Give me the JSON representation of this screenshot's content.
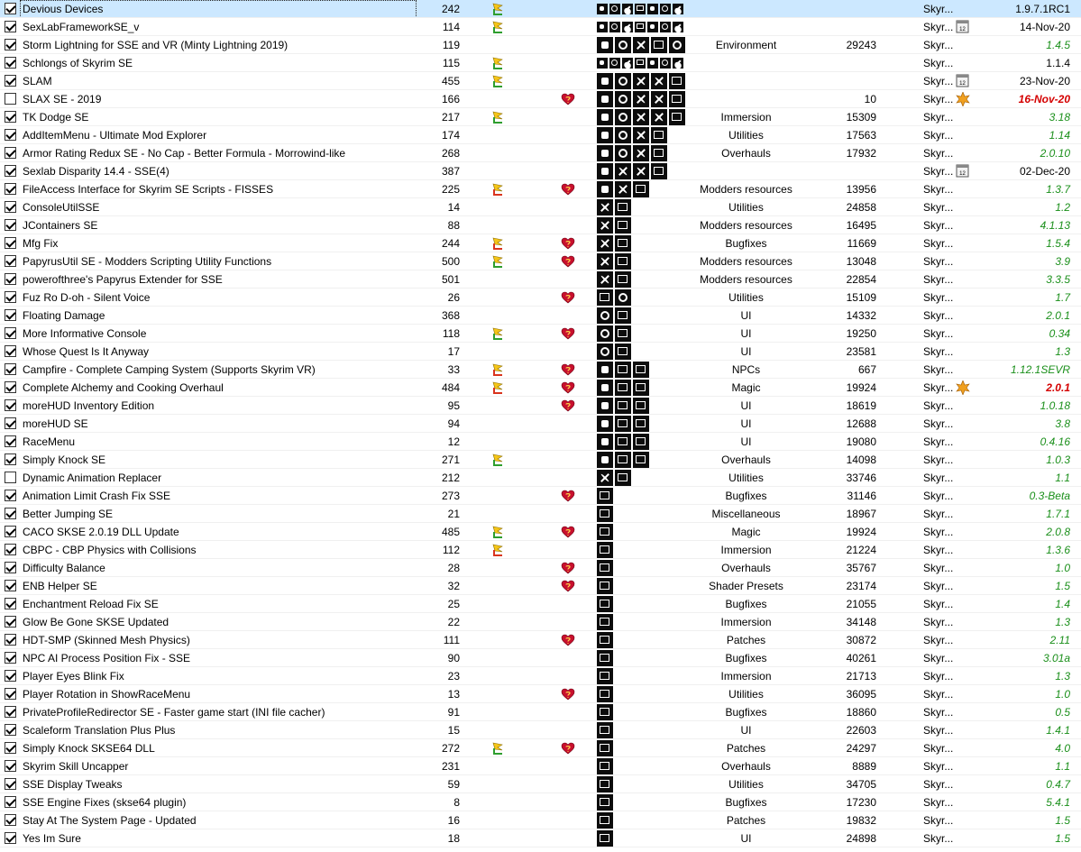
{
  "rows": [
    {
      "name": "Devious Devices",
      "priority": "242",
      "flag": "green",
      "heart": false,
      "icons": [
        "c1",
        "c2",
        "c3",
        "c4",
        "c1",
        "c2",
        "c3"
      ],
      "small": true,
      "category": "",
      "nexus": "",
      "game": "Skyr...",
      "cal": false,
      "version": "1.9.7.1RC1",
      "vstyle": "plain",
      "checked": true,
      "selected": true
    },
    {
      "name": "SexLabFrameworkSE_v",
      "priority": "114",
      "flag": "green",
      "heart": false,
      "icons": [
        "c1",
        "c2",
        "c3",
        "c4",
        "c1",
        "c2",
        "c3"
      ],
      "small": true,
      "category": "",
      "nexus": "",
      "game": "Skyr...",
      "cal": true,
      "version": "14-Nov-20",
      "vstyle": "plain",
      "checked": true
    },
    {
      "name": "Storm Lightning for SSE and VR (Minty Lightning 2019)",
      "priority": "119",
      "flag": "",
      "heart": false,
      "icons": [
        "c1",
        "c2",
        "c3",
        "c4",
        "c2"
      ],
      "small": false,
      "category": "Environment",
      "nexus": "29243",
      "game": "Skyr...",
      "cal": false,
      "version": "1.4.5",
      "vstyle": "green",
      "checked": true
    },
    {
      "name": "Schlongs of Skyrim SE",
      "priority": "115",
      "flag": "green",
      "heart": false,
      "icons": [
        "c1",
        "c2",
        "c3",
        "c4",
        "c1",
        "c2",
        "c3"
      ],
      "small": true,
      "category": "",
      "nexus": "",
      "game": "Skyr...",
      "cal": false,
      "version": "1.1.4",
      "vstyle": "plain",
      "checked": true
    },
    {
      "name": "SLAM",
      "priority": "455",
      "flag": "green",
      "heart": false,
      "icons": [
        "c1",
        "c2",
        "c3",
        "c3",
        "c4"
      ],
      "small": false,
      "category": "",
      "nexus": "",
      "game": "Skyr...",
      "cal": true,
      "version": "23-Nov-20",
      "vstyle": "plain",
      "checked": true
    },
    {
      "name": "SLAX SE - 2019",
      "priority": "166",
      "flag": "",
      "heart": true,
      "icons": [
        "c1",
        "c2",
        "c3",
        "c3",
        "c4"
      ],
      "small": false,
      "category": "",
      "nexus": "10",
      "game": "Skyr...",
      "cal": false,
      "version": "16-Nov-20",
      "vstyle": "red",
      "checked": false,
      "alert": true
    },
    {
      "name": "TK Dodge SE",
      "priority": "217",
      "flag": "green",
      "heart": false,
      "icons": [
        "c1",
        "c2",
        "c3",
        "c3",
        "c4"
      ],
      "small": false,
      "category": "Immersion",
      "nexus": "15309",
      "game": "Skyr...",
      "cal": false,
      "version": "3.18",
      "vstyle": "green",
      "checked": true
    },
    {
      "name": "AddItemMenu - Ultimate Mod Explorer",
      "priority": "174",
      "flag": "",
      "heart": false,
      "icons": [
        "c1",
        "c2",
        "c3",
        "c4"
      ],
      "small": false,
      "category": "Utilities",
      "nexus": "17563",
      "game": "Skyr...",
      "cal": false,
      "version": "1.14",
      "vstyle": "green",
      "checked": true
    },
    {
      "name": "Armor Rating Redux SE - No Cap - Better Formula - Morrowind-like",
      "priority": "268",
      "flag": "",
      "heart": false,
      "icons": [
        "c1",
        "c2",
        "c3",
        "c4"
      ],
      "small": false,
      "category": "Overhauls",
      "nexus": "17932",
      "game": "Skyr...",
      "cal": false,
      "version": "2.0.10",
      "vstyle": "green",
      "checked": true
    },
    {
      "name": "Sexlab Disparity 14.4 - SSE(4)",
      "priority": "387",
      "flag": "",
      "heart": false,
      "icons": [
        "c1",
        "c3",
        "c3",
        "c4"
      ],
      "small": false,
      "category": "",
      "nexus": "",
      "game": "Skyr...",
      "cal": true,
      "version": "02-Dec-20",
      "vstyle": "plain",
      "checked": true
    },
    {
      "name": "FileAccess Interface for Skyrim SE Scripts - FISSES",
      "priority": "225",
      "flag": "red",
      "heart": true,
      "icons": [
        "c1",
        "c3",
        "c4"
      ],
      "small": false,
      "category": "Modders resources",
      "nexus": "13956",
      "game": "Skyr...",
      "cal": false,
      "version": "1.3.7",
      "vstyle": "green",
      "checked": true
    },
    {
      "name": "ConsoleUtilSSE",
      "priority": "14",
      "flag": "",
      "heart": false,
      "icons": [
        "c3",
        "c4"
      ],
      "small": false,
      "category": "Utilities",
      "nexus": "24858",
      "game": "Skyr...",
      "cal": false,
      "version": "1.2",
      "vstyle": "green",
      "checked": true
    },
    {
      "name": "JContainers SE",
      "priority": "88",
      "flag": "",
      "heart": false,
      "icons": [
        "c3",
        "c4"
      ],
      "small": false,
      "category": "Modders resources",
      "nexus": "16495",
      "game": "Skyr...",
      "cal": false,
      "version": "4.1.13",
      "vstyle": "green",
      "checked": true
    },
    {
      "name": "Mfg Fix",
      "priority": "244",
      "flag": "red",
      "heart": true,
      "icons": [
        "c3",
        "c4"
      ],
      "small": false,
      "category": "Bugfixes",
      "nexus": "11669",
      "game": "Skyr...",
      "cal": false,
      "version": "1.5.4",
      "vstyle": "green",
      "checked": true
    },
    {
      "name": "PapyrusUtil SE - Modders Scripting Utility Functions",
      "priority": "500",
      "flag": "green",
      "heart": true,
      "icons": [
        "c3",
        "c4"
      ],
      "small": false,
      "category": "Modders resources",
      "nexus": "13048",
      "game": "Skyr...",
      "cal": false,
      "version": "3.9",
      "vstyle": "green",
      "checked": true
    },
    {
      "name": "powerofthree's Papyrus Extender for SSE",
      "priority": "501",
      "flag": "",
      "heart": false,
      "icons": [
        "c3",
        "c4"
      ],
      "small": false,
      "category": "Modders resources",
      "nexus": "22854",
      "game": "Skyr...",
      "cal": false,
      "version": "3.3.5",
      "vstyle": "green",
      "checked": true
    },
    {
      "name": "Fuz Ro D-oh - Silent Voice",
      "priority": "26",
      "flag": "",
      "heart": true,
      "icons": [
        "c4",
        "c2"
      ],
      "small": false,
      "category": "Utilities",
      "nexus": "15109",
      "game": "Skyr...",
      "cal": false,
      "version": "1.7",
      "vstyle": "green",
      "checked": true
    },
    {
      "name": "Floating Damage",
      "priority": "368",
      "flag": "",
      "heart": false,
      "icons": [
        "c2",
        "c4"
      ],
      "small": false,
      "category": "UI",
      "nexus": "14332",
      "game": "Skyr...",
      "cal": false,
      "version": "2.0.1",
      "vstyle": "green",
      "checked": true
    },
    {
      "name": "More Informative Console",
      "priority": "118",
      "flag": "green",
      "heart": true,
      "icons": [
        "c2",
        "c4"
      ],
      "small": false,
      "category": "UI",
      "nexus": "19250",
      "game": "Skyr...",
      "cal": false,
      "version": "0.34",
      "vstyle": "green",
      "checked": true
    },
    {
      "name": "Whose Quest Is It Anyway",
      "priority": "17",
      "flag": "",
      "heart": false,
      "icons": [
        "c2",
        "c4"
      ],
      "small": false,
      "category": "UI",
      "nexus": "23581",
      "game": "Skyr...",
      "cal": false,
      "version": "1.3",
      "vstyle": "green",
      "checked": true
    },
    {
      "name": "Campfire - Complete Camping System (Supports Skyrim VR)",
      "priority": "33",
      "flag": "red",
      "heart": true,
      "icons": [
        "c1",
        "c4",
        "c4"
      ],
      "small": false,
      "category": "NPCs",
      "nexus": "667",
      "game": "Skyr...",
      "cal": false,
      "version": "1.12.1SEVR",
      "vstyle": "green",
      "checked": true
    },
    {
      "name": "Complete Alchemy and Cooking Overhaul",
      "priority": "484",
      "flag": "red",
      "heart": true,
      "icons": [
        "c1",
        "c4",
        "c4"
      ],
      "small": false,
      "category": "Magic",
      "nexus": "19924",
      "game": "Skyr...",
      "cal": false,
      "version": "2.0.1",
      "vstyle": "red",
      "checked": true,
      "alert": true
    },
    {
      "name": "moreHUD Inventory Edition",
      "priority": "95",
      "flag": "",
      "heart": true,
      "icons": [
        "c1",
        "c4",
        "c4"
      ],
      "small": false,
      "category": "UI",
      "nexus": "18619",
      "game": "Skyr...",
      "cal": false,
      "version": "1.0.18",
      "vstyle": "green",
      "checked": true
    },
    {
      "name": "moreHUD SE",
      "priority": "94",
      "flag": "",
      "heart": false,
      "icons": [
        "c1",
        "c4",
        "c4"
      ],
      "small": false,
      "category": "UI",
      "nexus": "12688",
      "game": "Skyr...",
      "cal": false,
      "version": "3.8",
      "vstyle": "green",
      "checked": true
    },
    {
      "name": "RaceMenu",
      "priority": "12",
      "flag": "",
      "heart": false,
      "icons": [
        "c1",
        "c4",
        "c4"
      ],
      "small": false,
      "category": "UI",
      "nexus": "19080",
      "game": "Skyr...",
      "cal": false,
      "version": "0.4.16",
      "vstyle": "green",
      "checked": true
    },
    {
      "name": "Simply Knock SE",
      "priority": "271",
      "flag": "green",
      "heart": false,
      "icons": [
        "c1",
        "c4",
        "c4"
      ],
      "small": false,
      "category": "Overhauls",
      "nexus": "14098",
      "game": "Skyr...",
      "cal": false,
      "version": "1.0.3",
      "vstyle": "green",
      "checked": true
    },
    {
      "name": "Dynamic Animation Replacer",
      "priority": "212",
      "flag": "",
      "heart": false,
      "icons": [
        "c3",
        "c4"
      ],
      "small": false,
      "category": "Utilities",
      "nexus": "33746",
      "game": "Skyr...",
      "cal": false,
      "version": "1.1",
      "vstyle": "green",
      "checked": false
    },
    {
      "name": "Animation Limit Crash Fix SSE",
      "priority": "273",
      "flag": "",
      "heart": true,
      "icons": [
        "c4"
      ],
      "small": false,
      "category": "Bugfixes",
      "nexus": "31146",
      "game": "Skyr...",
      "cal": false,
      "version": "0.3-Beta",
      "vstyle": "green",
      "checked": true
    },
    {
      "name": "Better Jumping SE",
      "priority": "21",
      "flag": "",
      "heart": false,
      "icons": [
        "c4"
      ],
      "small": false,
      "category": "Miscellaneous",
      "nexus": "18967",
      "game": "Skyr...",
      "cal": false,
      "version": "1.7.1",
      "vstyle": "green",
      "checked": true
    },
    {
      "name": "CACO SKSE 2.0.19 DLL Update",
      "priority": "485",
      "flag": "green",
      "heart": true,
      "icons": [
        "c4"
      ],
      "small": false,
      "category": "Magic",
      "nexus": "19924",
      "game": "Skyr...",
      "cal": false,
      "version": "2.0.8",
      "vstyle": "green",
      "checked": true
    },
    {
      "name": "CBPC - CBP Physics with Collisions",
      "priority": "112",
      "flag": "red",
      "heart": false,
      "icons": [
        "c4"
      ],
      "small": false,
      "category": "Immersion",
      "nexus": "21224",
      "game": "Skyr...",
      "cal": false,
      "version": "1.3.6",
      "vstyle": "green",
      "checked": true
    },
    {
      "name": "Difficulty Balance",
      "priority": "28",
      "flag": "",
      "heart": true,
      "icons": [
        "c4"
      ],
      "small": false,
      "category": "Overhauls",
      "nexus": "35767",
      "game": "Skyr...",
      "cal": false,
      "version": "1.0",
      "vstyle": "green",
      "checked": true
    },
    {
      "name": "ENB Helper SE",
      "priority": "32",
      "flag": "",
      "heart": true,
      "icons": [
        "c4"
      ],
      "small": false,
      "category": "Shader Presets",
      "nexus": "23174",
      "game": "Skyr...",
      "cal": false,
      "version": "1.5",
      "vstyle": "green",
      "checked": true
    },
    {
      "name": "Enchantment Reload Fix SE",
      "priority": "25",
      "flag": "",
      "heart": false,
      "icons": [
        "c4"
      ],
      "small": false,
      "category": "Bugfixes",
      "nexus": "21055",
      "game": "Skyr...",
      "cal": false,
      "version": "1.4",
      "vstyle": "green",
      "checked": true
    },
    {
      "name": "Glow Be Gone SKSE Updated",
      "priority": "22",
      "flag": "",
      "heart": false,
      "icons": [
        "c4"
      ],
      "small": false,
      "category": "Immersion",
      "nexus": "34148",
      "game": "Skyr...",
      "cal": false,
      "version": "1.3",
      "vstyle": "green",
      "checked": true
    },
    {
      "name": "HDT-SMP (Skinned Mesh Physics)",
      "priority": "111",
      "flag": "",
      "heart": true,
      "icons": [
        "c4"
      ],
      "small": false,
      "category": "Patches",
      "nexus": "30872",
      "game": "Skyr...",
      "cal": false,
      "version": "2.11",
      "vstyle": "green",
      "checked": true
    },
    {
      "name": "NPC AI Process Position Fix - SSE",
      "priority": "90",
      "flag": "",
      "heart": false,
      "icons": [
        "c4"
      ],
      "small": false,
      "category": "Bugfixes",
      "nexus": "40261",
      "game": "Skyr...",
      "cal": false,
      "version": "3.01a",
      "vstyle": "green",
      "checked": true
    },
    {
      "name": "Player Eyes Blink Fix",
      "priority": "23",
      "flag": "",
      "heart": false,
      "icons": [
        "c4"
      ],
      "small": false,
      "category": "Immersion",
      "nexus": "21713",
      "game": "Skyr...",
      "cal": false,
      "version": "1.3",
      "vstyle": "green",
      "checked": true
    },
    {
      "name": "Player Rotation in ShowRaceMenu",
      "priority": "13",
      "flag": "",
      "heart": true,
      "icons": [
        "c4"
      ],
      "small": false,
      "category": "Utilities",
      "nexus": "36095",
      "game": "Skyr...",
      "cal": false,
      "version": "1.0",
      "vstyle": "green",
      "checked": true
    },
    {
      "name": "PrivateProfileRedirector SE - Faster game start (INI file cacher)",
      "priority": "91",
      "flag": "",
      "heart": false,
      "icons": [
        "c4"
      ],
      "small": false,
      "category": "Bugfixes",
      "nexus": "18860",
      "game": "Skyr...",
      "cal": false,
      "version": "0.5",
      "vstyle": "green",
      "checked": true
    },
    {
      "name": "Scaleform Translation Plus Plus",
      "priority": "15",
      "flag": "",
      "heart": false,
      "icons": [
        "c4"
      ],
      "small": false,
      "category": "UI",
      "nexus": "22603",
      "game": "Skyr...",
      "cal": false,
      "version": "1.4.1",
      "vstyle": "green",
      "checked": true
    },
    {
      "name": "Simply Knock SKSE64 DLL",
      "priority": "272",
      "flag": "green",
      "heart": true,
      "icons": [
        "c4"
      ],
      "small": false,
      "category": "Patches",
      "nexus": "24297",
      "game": "Skyr...",
      "cal": false,
      "version": "4.0",
      "vstyle": "green",
      "checked": true
    },
    {
      "name": "Skyrim Skill Uncapper",
      "priority": "231",
      "flag": "",
      "heart": false,
      "icons": [
        "c4"
      ],
      "small": false,
      "category": "Overhauls",
      "nexus": "8889",
      "game": "Skyr...",
      "cal": false,
      "version": "1.1",
      "vstyle": "green",
      "checked": true
    },
    {
      "name": "SSE Display Tweaks",
      "priority": "59",
      "flag": "",
      "heart": false,
      "icons": [
        "c4"
      ],
      "small": false,
      "category": "Utilities",
      "nexus": "34705",
      "game": "Skyr...",
      "cal": false,
      "version": "0.4.7",
      "vstyle": "green",
      "checked": true
    },
    {
      "name": "SSE Engine Fixes (skse64 plugin)",
      "priority": "8",
      "flag": "",
      "heart": false,
      "icons": [
        "c4"
      ],
      "small": false,
      "category": "Bugfixes",
      "nexus": "17230",
      "game": "Skyr...",
      "cal": false,
      "version": "5.4.1",
      "vstyle": "green",
      "checked": true
    },
    {
      "name": "Stay At The System Page - Updated",
      "priority": "16",
      "flag": "",
      "heart": false,
      "icons": [
        "c4"
      ],
      "small": false,
      "category": "Patches",
      "nexus": "19832",
      "game": "Skyr...",
      "cal": false,
      "version": "1.5",
      "vstyle": "green",
      "checked": true
    },
    {
      "name": "Yes Im Sure",
      "priority": "18",
      "flag": "",
      "heart": false,
      "icons": [
        "c4"
      ],
      "small": false,
      "category": "UI",
      "nexus": "24898",
      "game": "Skyr...",
      "cal": false,
      "version": "1.5",
      "vstyle": "green",
      "checked": true
    }
  ],
  "colors": {
    "selected_row": "#cce8ff",
    "version_green": "#1a8f1a",
    "version_red": "#d40000",
    "flag_green": "#2e9e2e",
    "flag_red": "#d9341e",
    "flag_yellow": "#f5c518",
    "heart": "#c8102e",
    "alert": "#f0a020"
  },
  "icon_names": {
    "flag": "flag-icon",
    "heart": "endorsed-heart-icon",
    "calendar": "calendar-icon",
    "alert": "update-alert-icon",
    "content": "content-type-icon"
  }
}
